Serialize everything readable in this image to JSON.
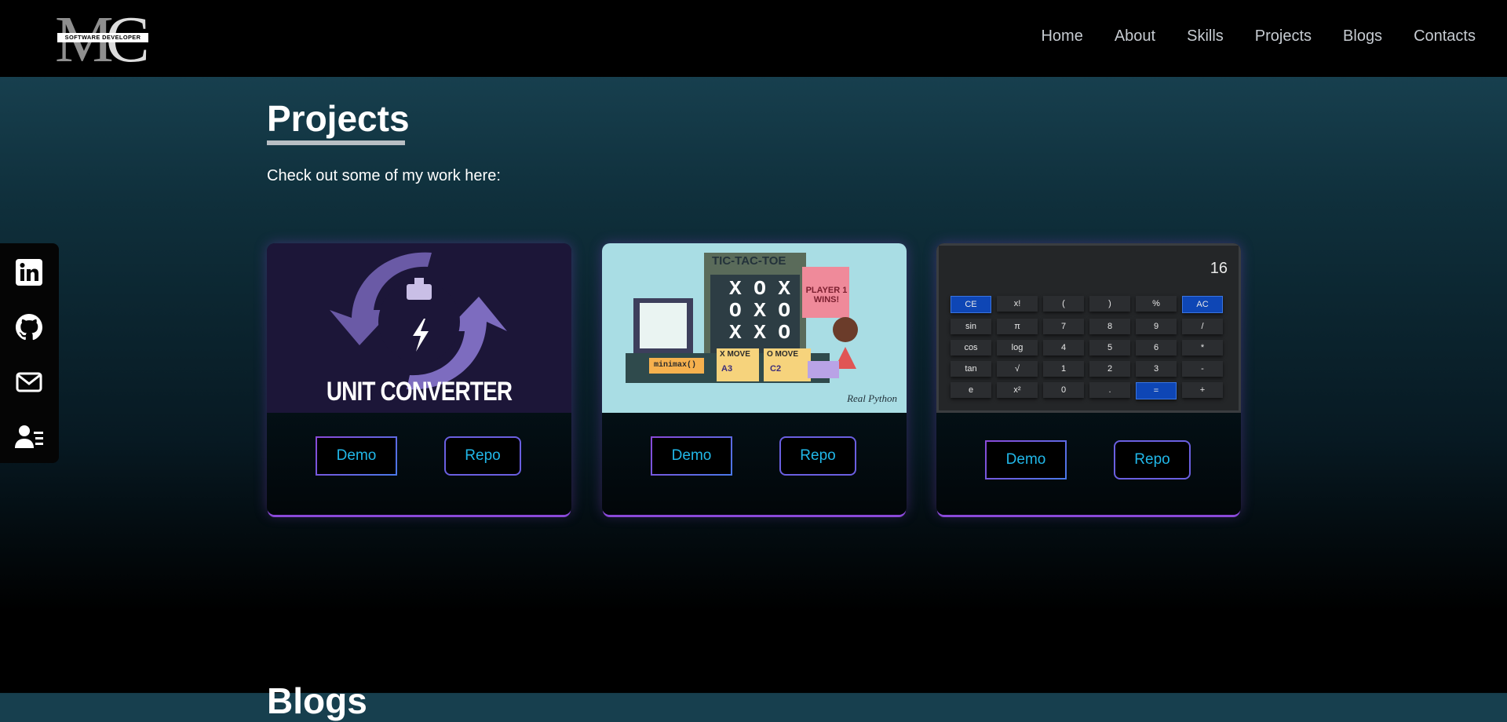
{
  "nav": {
    "logo_text": "SOFTWARE DEVELOPER",
    "links": [
      "Home",
      "About",
      "Skills",
      "Projects",
      "Blogs",
      "Contacts"
    ]
  },
  "social": [
    "linkedin-icon",
    "github-icon",
    "mail-icon",
    "contact-card-icon"
  ],
  "projects_section": {
    "title": "Projects",
    "subtitle": "Check out some of my work here:"
  },
  "cards": [
    {
      "image_text": "UNIT CONVERTER",
      "demo": "Demo",
      "repo": "Repo"
    },
    {
      "image_title": "TIC-TAC-TOE",
      "image_badge": "PLAYER 1 WINS!",
      "image_code": "minimax()",
      "x_move": "X MOVE",
      "o_move": "O MOVE",
      "x_cell": "A3",
      "o_cell": "C2",
      "image_brand": "Real Python",
      "demo": "Demo",
      "repo": "Repo"
    },
    {
      "display": "16",
      "keys": [
        [
          "CE",
          "x!",
          "(",
          ")",
          "%",
          "AC"
        ],
        [
          "sin",
          "π",
          "7",
          "8",
          "9",
          "/"
        ],
        [
          "cos",
          "log",
          "4",
          "5",
          "6",
          "*"
        ],
        [
          "tan",
          "√",
          "1",
          "2",
          "3",
          "-"
        ],
        [
          "e",
          "x²",
          "0",
          ".",
          "=",
          "+"
        ]
      ],
      "demo": "Demo",
      "repo": "Repo"
    }
  ],
  "next_section_title": "Blogs",
  "colors": {
    "accent_purple": "#8a49d8",
    "button_text": "#21b7e8",
    "nav_bg": "#000000"
  }
}
